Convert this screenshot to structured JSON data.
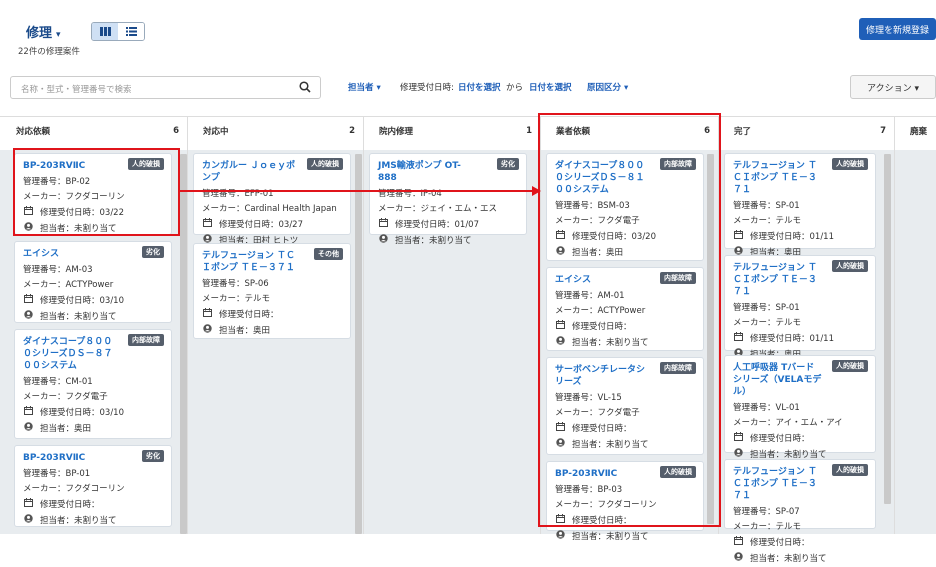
{
  "header": {
    "title": "修理",
    "caret": "▾",
    "count": "22件の修理案件",
    "new_button": "修理を新規登録"
  },
  "filters": {
    "search_placeholder": "名称・型式・管理番号で検索",
    "assignee": "担当者 ▾",
    "received_label": "修理受付日時:",
    "date_from": "日付を選択",
    "range_word": "から",
    "date_to": "日付を選択",
    "cause": "原因区分 ▾",
    "action_button": "アクション ▾"
  },
  "columns": [
    {
      "name": "対応依頼",
      "count": "6",
      "cards": [
        {
          "name": "BP-203RVⅡC",
          "badge": "人的破損",
          "mgmt": "管理番号：BP-02",
          "maker": "メーカー：フクダコーリン",
          "date": "修理受付日時：03/22",
          "assignee": "担当者：未割り当て"
        },
        {
          "name": "エイシス",
          "badge": "劣化",
          "mgmt": "管理番号：AM-03",
          "maker": "メーカー：ACTYPower",
          "date": "修理受付日時：03/10",
          "assignee": "担当者：未割り当て"
        },
        {
          "name": "ダイナスコープ８０００シリーズＤＳ－８７００システム",
          "badge": "内部故障",
          "mgmt": "管理番号：CM-01",
          "maker": "メーカー：フクダ電子",
          "date": "修理受付日時：03/10",
          "assignee": "担当者：奥田"
        },
        {
          "name": "BP-203RVⅡC",
          "badge": "劣化",
          "mgmt": "管理番号：BP-01",
          "maker": "メーカー：フクダコーリン",
          "date": "修理受付日時：",
          "assignee": "担当者：未割り当て"
        }
      ]
    },
    {
      "name": "対応中",
      "count": "2",
      "cards": [
        {
          "name": "カンガルー Ｊｏｅｙポンプ",
          "badge": "人的破損",
          "mgmt": "管理番号：EFP-01",
          "maker": "メーカー：Cardinal Health Japan",
          "date": "修理受付日時：03/27",
          "assignee": "担当者：田村 ヒトツ"
        },
        {
          "name": "テルフュージョン ＴＣＩポンプ ＴＥ－３７１",
          "badge": "その他",
          "mgmt": "管理番号：SP-06",
          "maker": "メーカー：テルモ",
          "date": "修理受付日時：",
          "assignee": "担当者：奥田"
        }
      ]
    },
    {
      "name": "院内修理",
      "count": "1",
      "cards": [
        {
          "name": "JMS輸液ポンプ OT-888",
          "badge": "劣化",
          "mgmt": "管理番号：IP-04",
          "maker": "メーカー：ジェイ・エム・エス",
          "date": "修理受付日時：01/07",
          "assignee": "担当者：未割り当て"
        }
      ]
    },
    {
      "name": "業者依頼",
      "count": "6",
      "cards": [
        {
          "name": "ダイナスコープ８０００シリーズＤＳ－８１００システム",
          "badge": "内部故障",
          "mgmt": "管理番号：BSM-03",
          "maker": "メーカー：フクダ電子",
          "date": "修理受付日時：03/20",
          "assignee": "担当者：奥田"
        },
        {
          "name": "エイシス",
          "badge": "内部故障",
          "mgmt": "管理番号：AM-01",
          "maker": "メーカー：ACTYPower",
          "date": "修理受付日時：",
          "assignee": "担当者：未割り当て"
        },
        {
          "name": "サーボベンチレータシリーズ",
          "badge": "内部故障",
          "mgmt": "管理番号：VL-15",
          "maker": "メーカー：フクダ電子",
          "date": "修理受付日時：",
          "assignee": "担当者：未割り当て"
        },
        {
          "name": "BP-203RVⅡC",
          "badge": "人的破損",
          "mgmt": "管理番号：BP-03",
          "maker": "メーカー：フクダコーリン",
          "date": "修理受付日時：",
          "assignee": "担当者：未割り当て"
        }
      ]
    },
    {
      "name": "完了",
      "count": "7",
      "cards": [
        {
          "name": "テルフュージョン ＴＣＩポンプ ＴＥ－３７１",
          "badge": "人的破損",
          "mgmt": "管理番号：SP-01",
          "maker": "メーカー：テルモ",
          "date": "修理受付日時：01/11",
          "assignee": "担当者：奥田"
        },
        {
          "name": "テルフュージョン ＴＣＩポンプ ＴＥ－３７１",
          "badge": "人的破損",
          "mgmt": "管理番号：SP-01",
          "maker": "メーカー：テルモ",
          "date": "修理受付日時：01/11",
          "assignee": "担当者：奥田"
        },
        {
          "name": "人工呼吸器 Tバード シリーズ（VELAモデル）",
          "badge": "人的破損",
          "mgmt": "管理番号：VL-01",
          "maker": "メーカー：アイ・エム・アイ",
          "date": "修理受付日時：",
          "assignee": "担当者：未割り当て"
        },
        {
          "name": "テルフュージョン ＴＣＩポンプ ＴＥ－３７１",
          "badge": "人的破損",
          "mgmt": "管理番号：SP-07",
          "maker": "メーカー：テルモ",
          "date": "修理受付日時：",
          "assignee": "担当者：未割り当て"
        }
      ]
    },
    {
      "name": "廃棄",
      "count": "",
      "cards": []
    }
  ],
  "colors": {
    "accent": "#1f5fb8",
    "highlight": "#e0141b",
    "badge": "#555e6b"
  }
}
